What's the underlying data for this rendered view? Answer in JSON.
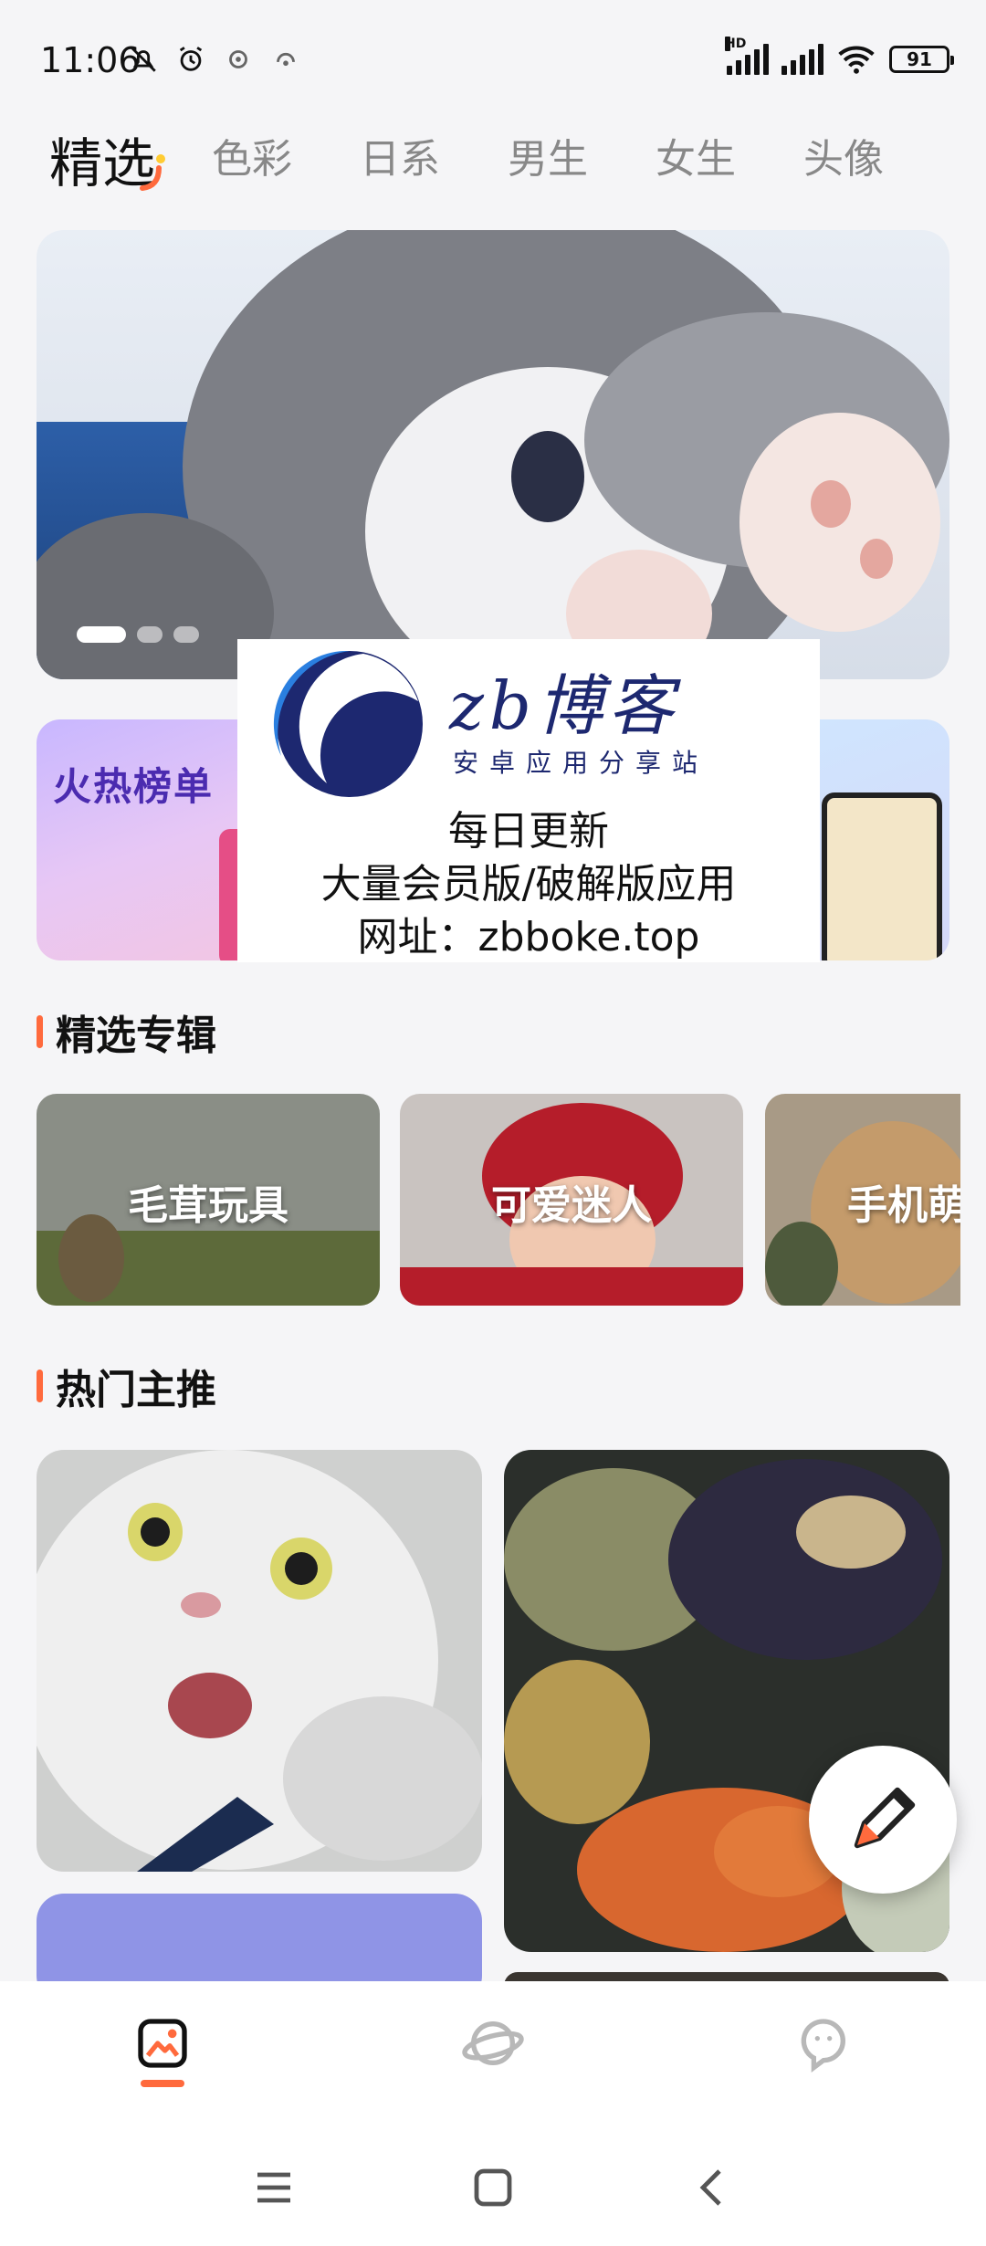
{
  "status_bar": {
    "time": "11:06",
    "battery": "91",
    "network_tag": "HD"
  },
  "tabs": [
    {
      "label": "精选",
      "active": true
    },
    {
      "label": "色彩",
      "active": false
    },
    {
      "label": "日系",
      "active": false
    },
    {
      "label": "男生",
      "active": false
    },
    {
      "label": "女生",
      "active": false
    },
    {
      "label": "头像",
      "active": false
    }
  ],
  "banner": {
    "dots": 3,
    "active_dot": 1
  },
  "feature_cards": {
    "hot_list_label": "火热榜单"
  },
  "watermark": {
    "brand": "zb博客",
    "tagline": "安卓应用分享站",
    "line1": "每日更新",
    "line2": "大量会员版/破解版应用",
    "line3": "网址：zbboke.top"
  },
  "sections": {
    "albums_title": "精选专辑",
    "hot_title": "热门主推"
  },
  "albums": [
    {
      "label": "毛茸玩具"
    },
    {
      "label": "可爱迷人"
    },
    {
      "label": "手机萌"
    }
  ],
  "colors": {
    "accent": "#ff6a3d",
    "brand_blue": "#1d2870",
    "hot_list_text": "#4b2bb0"
  },
  "bottom_nav": [
    {
      "icon": "gallery-icon",
      "active": true
    },
    {
      "icon": "planet-icon",
      "active": false
    },
    {
      "icon": "chat-icon",
      "active": false
    }
  ]
}
